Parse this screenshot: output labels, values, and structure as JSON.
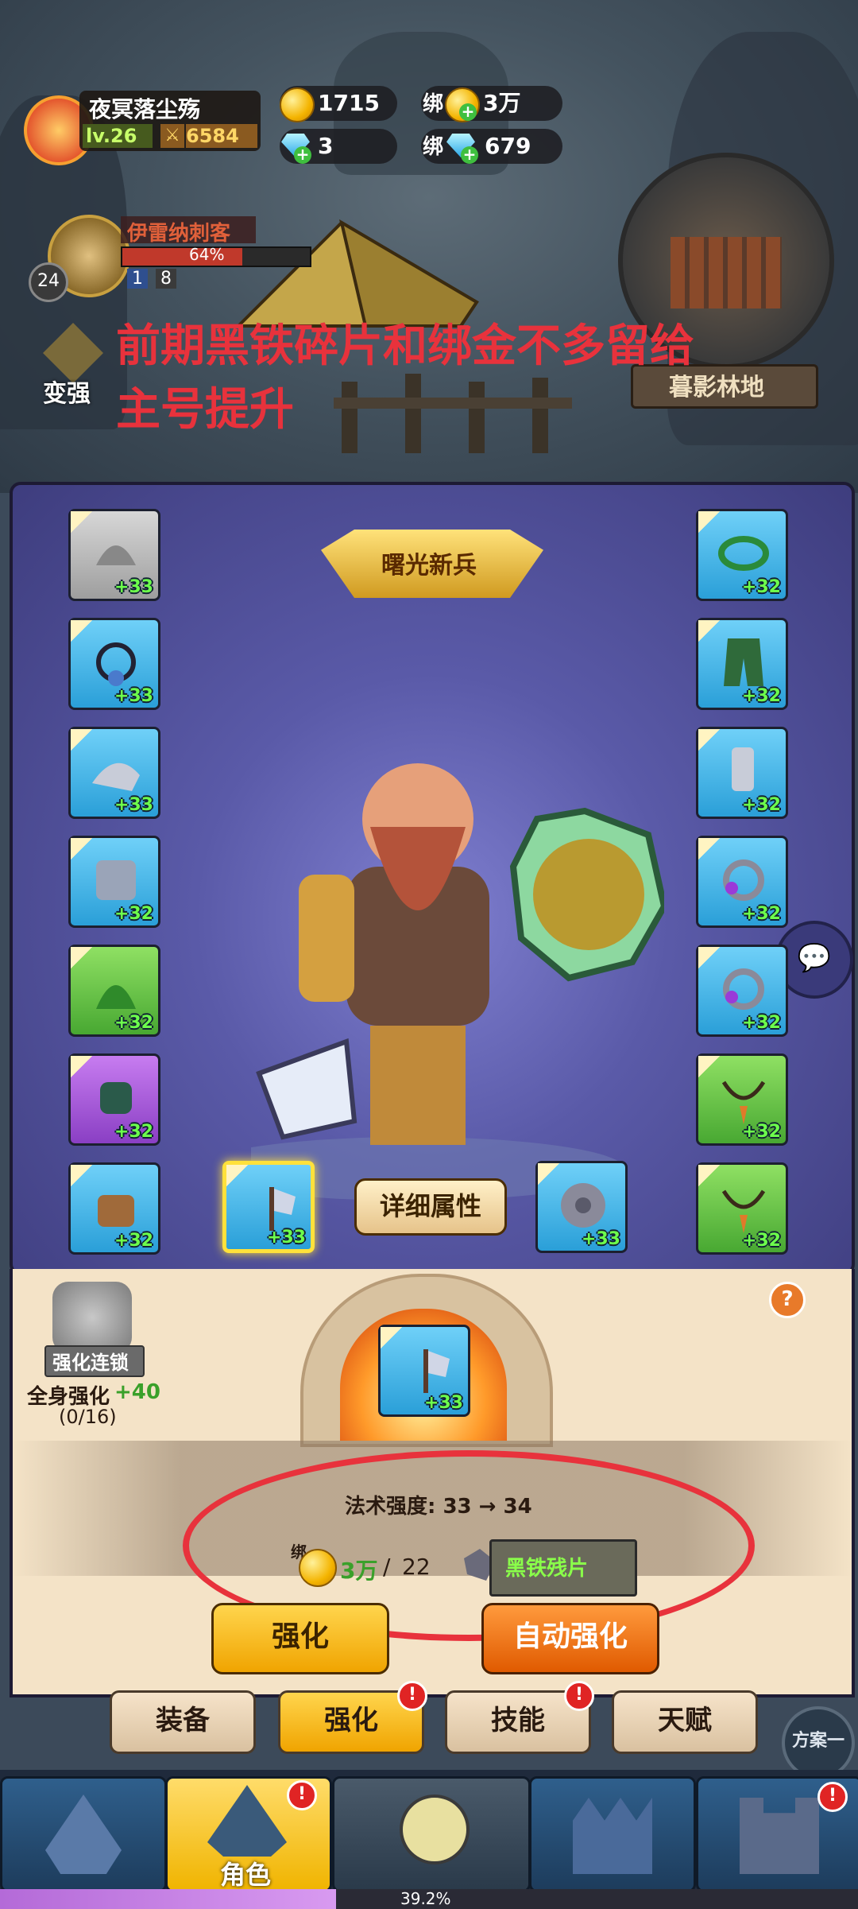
{
  "player": {
    "name": "夜冥落尘殇",
    "level": "lv.26",
    "power": "6584"
  },
  "currency": {
    "gold": "1715",
    "bound_label_1": "绑",
    "bound_gold": "3万",
    "diamond": "3",
    "bound_label_2": "绑",
    "bound_diamond": "679"
  },
  "companion": {
    "name": "伊雷纳刺客",
    "progress": "64%",
    "level": "24",
    "stat_a": "1",
    "stat_b": "8"
  },
  "become_strong": "变强",
  "map_name": "暮影林地",
  "annotation": {
    "line1": "前期黑铁碎片和绑金不多留给",
    "line2": "主号提升"
  },
  "title_banner": "曙光新兵",
  "left_slots": [
    "+33",
    "+33",
    "+33",
    "+32",
    "+32",
    "+32",
    "+32"
  ],
  "right_slots": [
    "+32",
    "+32",
    "+32",
    "+32",
    "+32",
    "+32",
    "+32"
  ],
  "bottom_slots": {
    "weapon": "+33",
    "shield": "+33"
  },
  "detail_button": "详细属性",
  "forge": {
    "chain_label": "强化连锁",
    "full_body_label": "全身强化",
    "full_body_bonus": "+40",
    "full_body_progress": "(0/16)",
    "item_level": "+33",
    "stat_line": "法术强度: 33 → 34",
    "cost_bound": "绑",
    "cost_value": "3万",
    "cost_separator": "/",
    "cost_owned": "22",
    "material_name": "黑铁残片",
    "btn_enhance": "强化",
    "btn_auto": "自动强化",
    "help": "?"
  },
  "tabs": [
    {
      "label": "装备",
      "badge": ""
    },
    {
      "label": "强化",
      "badge": "!"
    },
    {
      "label": "技能",
      "badge": "!"
    },
    {
      "label": "天赋",
      "badge": ""
    }
  ],
  "plan_button": "方案一",
  "nav": {
    "active_label": "角色",
    "badge": "!"
  },
  "bottom_progress": "39.2%",
  "colors": {
    "accent_gold": "#f0a400",
    "highlight_red": "#e8323c",
    "level_green": "#6dff4c"
  }
}
